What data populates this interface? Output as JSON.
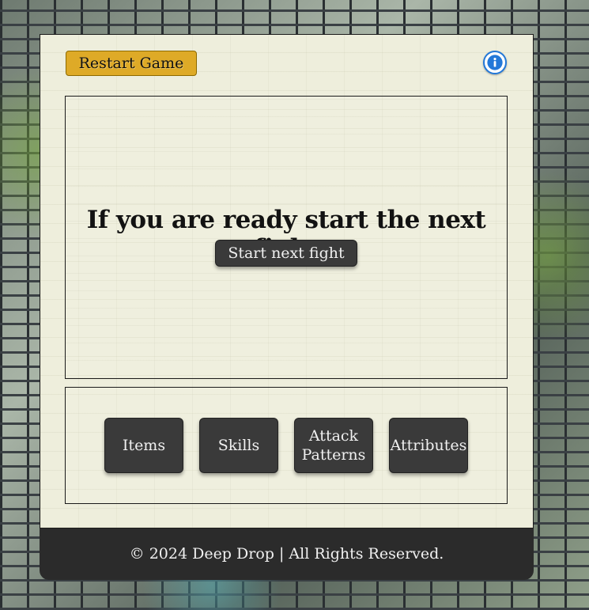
{
  "header": {
    "restart_label": "Restart Game",
    "info_icon": "info-icon"
  },
  "fight": {
    "message": "If you are ready start the next fight",
    "start_label": "Start next fight"
  },
  "nav": {
    "items_label": "Items",
    "skills_label": "Skills",
    "attack_patterns_label": "Attack Patterns",
    "attributes_label": "Attributes"
  },
  "footer": {
    "copyright": "© 2024 Deep Drop | All Rights Reserved."
  },
  "colors": {
    "restart_button": "#deaa27",
    "panel_background": "#eeeedc",
    "dark_button": "#3a3a3a",
    "footer_background": "#2b2b2b",
    "info_accent": "#2378d8"
  }
}
